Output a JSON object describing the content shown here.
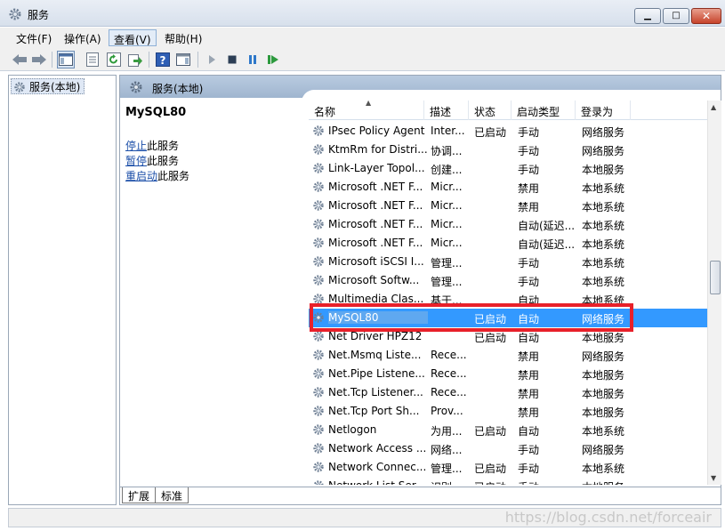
{
  "window": {
    "title": "服务"
  },
  "menu": [
    "文件(F)",
    "操作(A)",
    "查看(V)",
    "帮助(H)"
  ],
  "tree": {
    "root_label": "服务(本地)"
  },
  "pane": {
    "header_title": "服务(本地)",
    "detail_title": "MySQL80",
    "actions": [
      {
        "link": "停止",
        "suffix": "此服务"
      },
      {
        "link": "暂停",
        "suffix": "此服务"
      },
      {
        "link": "重启动",
        "suffix": "此服务"
      }
    ]
  },
  "list": {
    "columns": [
      "名称",
      "描述",
      "状态",
      "启动类型",
      "登录为"
    ],
    "rows": [
      {
        "name": "IPsec Policy Agent",
        "desc": "Inter...",
        "state": "已启动",
        "start": "手动",
        "logon": "网络服务"
      },
      {
        "name": "KtmRm for Distri...",
        "desc": "协调...",
        "state": "",
        "start": "手动",
        "logon": "网络服务"
      },
      {
        "name": "Link-Layer Topol...",
        "desc": "创建...",
        "state": "",
        "start": "手动",
        "logon": "本地服务"
      },
      {
        "name": "Microsoft .NET F...",
        "desc": "Micr...",
        "state": "",
        "start": "禁用",
        "logon": "本地系统"
      },
      {
        "name": "Microsoft .NET F...",
        "desc": "Micr...",
        "state": "",
        "start": "禁用",
        "logon": "本地系统"
      },
      {
        "name": "Microsoft .NET F...",
        "desc": "Micr...",
        "state": "",
        "start": "自动(延迟...",
        "logon": "本地系统"
      },
      {
        "name": "Microsoft .NET F...",
        "desc": "Micr...",
        "state": "",
        "start": "自动(延迟...",
        "logon": "本地系统"
      },
      {
        "name": "Microsoft iSCSI I...",
        "desc": "管理...",
        "state": "",
        "start": "手动",
        "logon": "本地系统"
      },
      {
        "name": "Microsoft Softw...",
        "desc": "管理...",
        "state": "",
        "start": "手动",
        "logon": "本地系统"
      },
      {
        "name": "Multimedia Clas...",
        "desc": "基于...",
        "state": "",
        "start": "自动",
        "logon": "本地系统"
      },
      {
        "name": "MySQL80",
        "desc": "",
        "state": "已启动",
        "start": "自动",
        "logon": "网络服务"
      },
      {
        "name": "Net Driver HPZ12",
        "desc": "",
        "state": "已启动",
        "start": "自动",
        "logon": "本地服务"
      },
      {
        "name": "Net.Msmq Liste...",
        "desc": "Rece...",
        "state": "",
        "start": "禁用",
        "logon": "网络服务"
      },
      {
        "name": "Net.Pipe Listene...",
        "desc": "Rece...",
        "state": "",
        "start": "禁用",
        "logon": "本地服务"
      },
      {
        "name": "Net.Tcp Listener...",
        "desc": "Rece...",
        "state": "",
        "start": "禁用",
        "logon": "本地服务"
      },
      {
        "name": "Net.Tcp Port Sh...",
        "desc": "Prov...",
        "state": "",
        "start": "禁用",
        "logon": "本地服务"
      },
      {
        "name": "Netlogon",
        "desc": "为用...",
        "state": "已启动",
        "start": "自动",
        "logon": "本地系统"
      },
      {
        "name": "Network Access ...",
        "desc": "网络...",
        "state": "",
        "start": "手动",
        "logon": "网络服务"
      },
      {
        "name": "Network Connec...",
        "desc": "管理...",
        "state": "已启动",
        "start": "手动",
        "logon": "本地系统"
      },
      {
        "name": "Network List Ser...",
        "desc": "识别...",
        "state": "已启动",
        "start": "手动",
        "logon": "本地服务"
      }
    ],
    "selected_index": 10
  },
  "tabs": [
    "扩展",
    "标准"
  ],
  "watermark": "https://blog.csdn.net/forceair",
  "colors": {
    "selection": "#3399ff",
    "highlight_box": "#e8202a",
    "link": "#1b4ea8"
  }
}
